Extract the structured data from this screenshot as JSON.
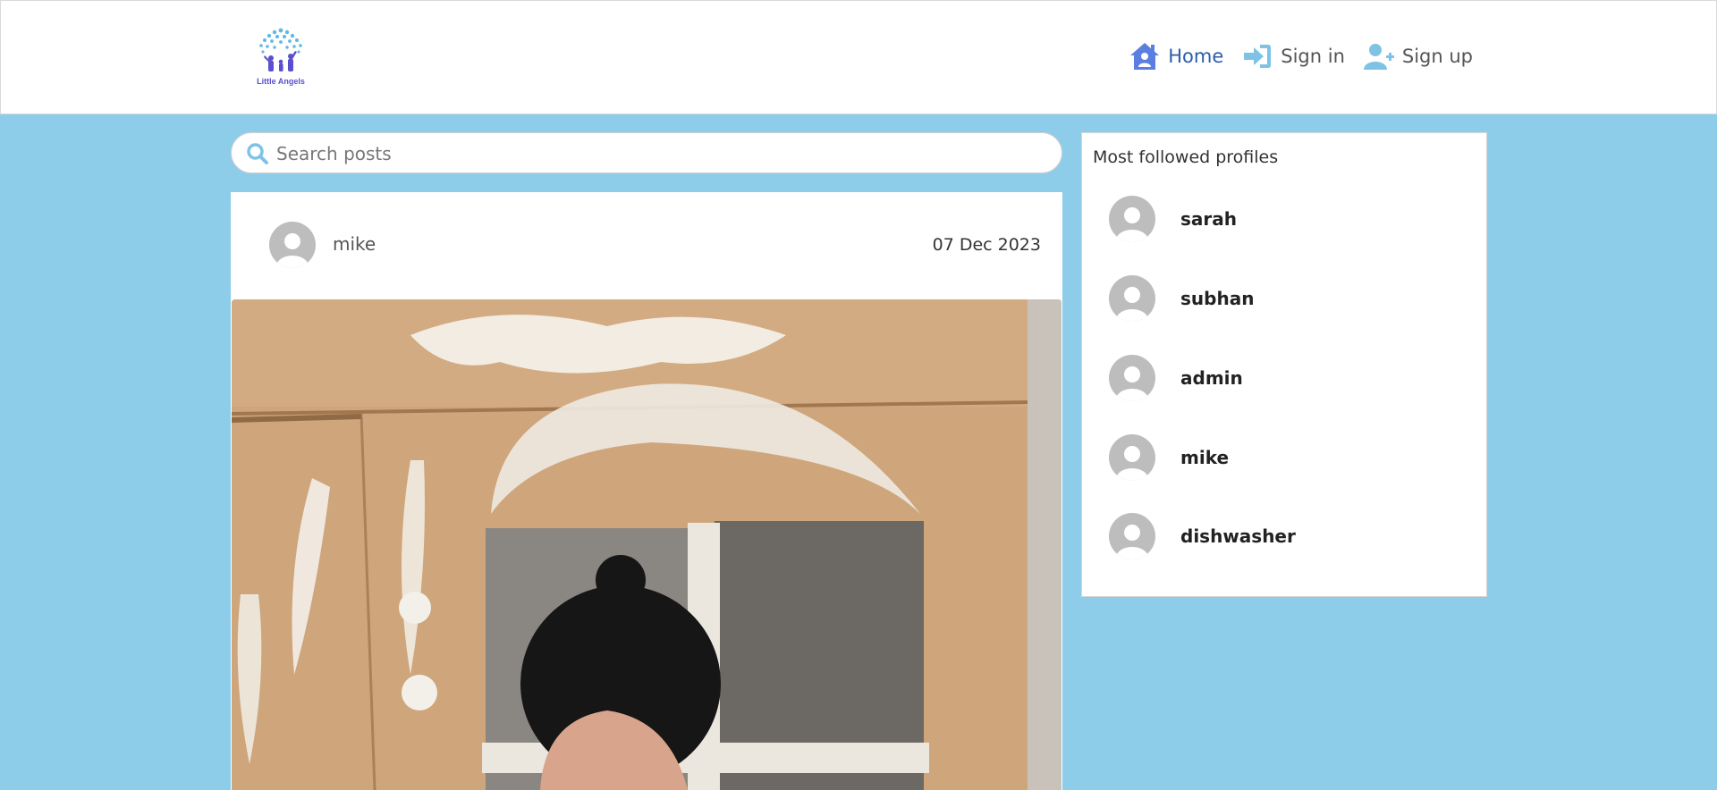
{
  "brand": {
    "logo_text": "Little Angels",
    "logo_icon": "family-tree-icon"
  },
  "nav": {
    "items": [
      {
        "label": "Home",
        "icon": "home-icon",
        "active": true
      },
      {
        "label": "Sign in",
        "icon": "sign-in-icon",
        "active": false
      },
      {
        "label": "Sign up",
        "icon": "user-plus-icon",
        "active": false
      }
    ]
  },
  "search": {
    "placeholder": "Search posts",
    "value": ""
  },
  "post": {
    "author": "mike",
    "date": "07 Dec 2023",
    "avatar_icon": "default-avatar-icon",
    "image_description_icon": "post-photo"
  },
  "sidebar": {
    "title": "Most followed profiles",
    "profiles": [
      {
        "name": "sarah"
      },
      {
        "name": "subhan"
      },
      {
        "name": "admin"
      },
      {
        "name": "mike"
      },
      {
        "name": "dishwasher"
      }
    ]
  },
  "colors": {
    "page_background": "#8ecdea",
    "accent_blue": "#5b7fe0",
    "light_blue": "#7ec3e6",
    "active_link": "#2a5ea8",
    "avatar_gray": "#bdbdbd"
  }
}
